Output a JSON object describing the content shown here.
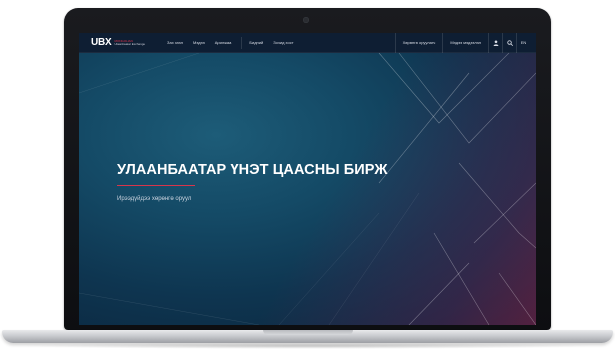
{
  "logo": {
    "mark": "UBX",
    "sub_line1": "MONGOLIAN",
    "sub_line2": "Ulaanbaatar Exchange"
  },
  "nav": {
    "items": [
      {
        "label": "Зах зээл"
      },
      {
        "label": "Мэдээ"
      },
      {
        "label": "Арилжаа"
      }
    ],
    "items_secondary": [
      {
        "label": "Бидний"
      },
      {
        "label": "Зочид хост"
      }
    ],
    "right": [
      {
        "label": "Хөрөнгө оруулагч"
      },
      {
        "label": "Мэдээ мэдээлэл"
      }
    ],
    "lang_label": "EN"
  },
  "hero": {
    "title": "УЛААНБААТАР ҮНЭТ ЦААСНЫ БИРЖ",
    "subtitle": "Ирээдүйдээ хөрөнгө оруул"
  },
  "colors": {
    "nav_bg": "#0e1e33",
    "accent_red": "#d8354b",
    "hero_bg": "#144a66"
  }
}
